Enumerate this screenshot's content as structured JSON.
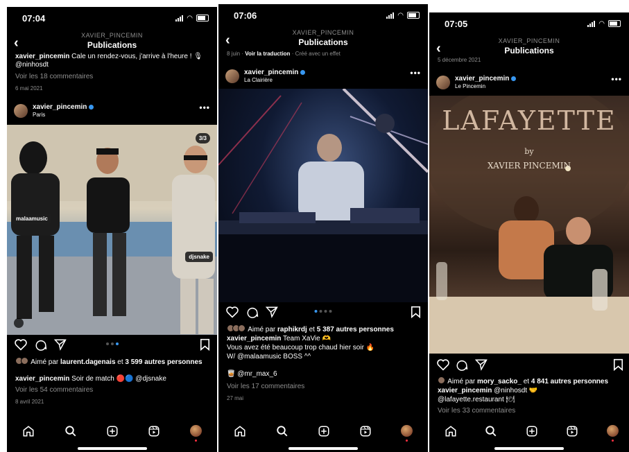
{
  "common": {
    "header_username": "XAVIER_PINCEMIN",
    "header_title": "Publications",
    "post_username": "xavier_pincemin"
  },
  "phone1": {
    "time": "07:04",
    "prev_caption_user": "xavier_pincemin",
    "prev_caption_text": "Cale un rendez-vous, j'arrive à l'heure ! 🎙 @ninhosdt",
    "prev_comments": "Voir les 18 commentaires",
    "prev_date": "6 mai 2021",
    "location": "Paris",
    "counter": "3/3",
    "tags": [
      "malaamusic",
      "djsnake"
    ],
    "liked_prefix": "Aimé par",
    "liked_user": "laurent.dagenais",
    "liked_suffix": "et",
    "liked_count": "3 599 autres personnes",
    "caption_text": "Soir de match 🔴🔵 @djsnake",
    "comments": "Voir les 54 commentaires",
    "date": "8 avril 2021"
  },
  "phone2": {
    "time": "07:06",
    "top_date": "8 juin",
    "see_translation": "Voir la traduction",
    "effect": "Créé avec un effet",
    "location": "La Clairière",
    "liked_prefix": "Aimé par",
    "liked_user": "raphikrdj",
    "liked_suffix": "et",
    "liked_count": "5 387 autres personnes",
    "caption_text": "Team XaVie 🫶",
    "caption_line2": "Vous avez été beaucoup trop chaud hier soir 🔥",
    "caption_line3": "W/ @malaamusic BOSS ^^",
    "comment_preview": "🥃 @mr_max_6",
    "comments": "Voir les 17 commentaires",
    "date": "27 mai"
  },
  "phone3": {
    "time": "07:05",
    "top_date": "5 décembre 2021",
    "location": "Le Pincemin",
    "photo_title": "LAFAYETTE",
    "photo_by": "by",
    "photo_author": "XAVIER PINCEMIN",
    "liked_prefix": "Aimé par",
    "liked_user": "mory_sacko_",
    "liked_suffix": "et",
    "liked_count": "4 841 autres personnes",
    "caption_text": "@ninhosdt 🤝",
    "caption_line2": "@lafayette.restaurant 🍽",
    "comments": "Voir les 33 commentaires"
  }
}
